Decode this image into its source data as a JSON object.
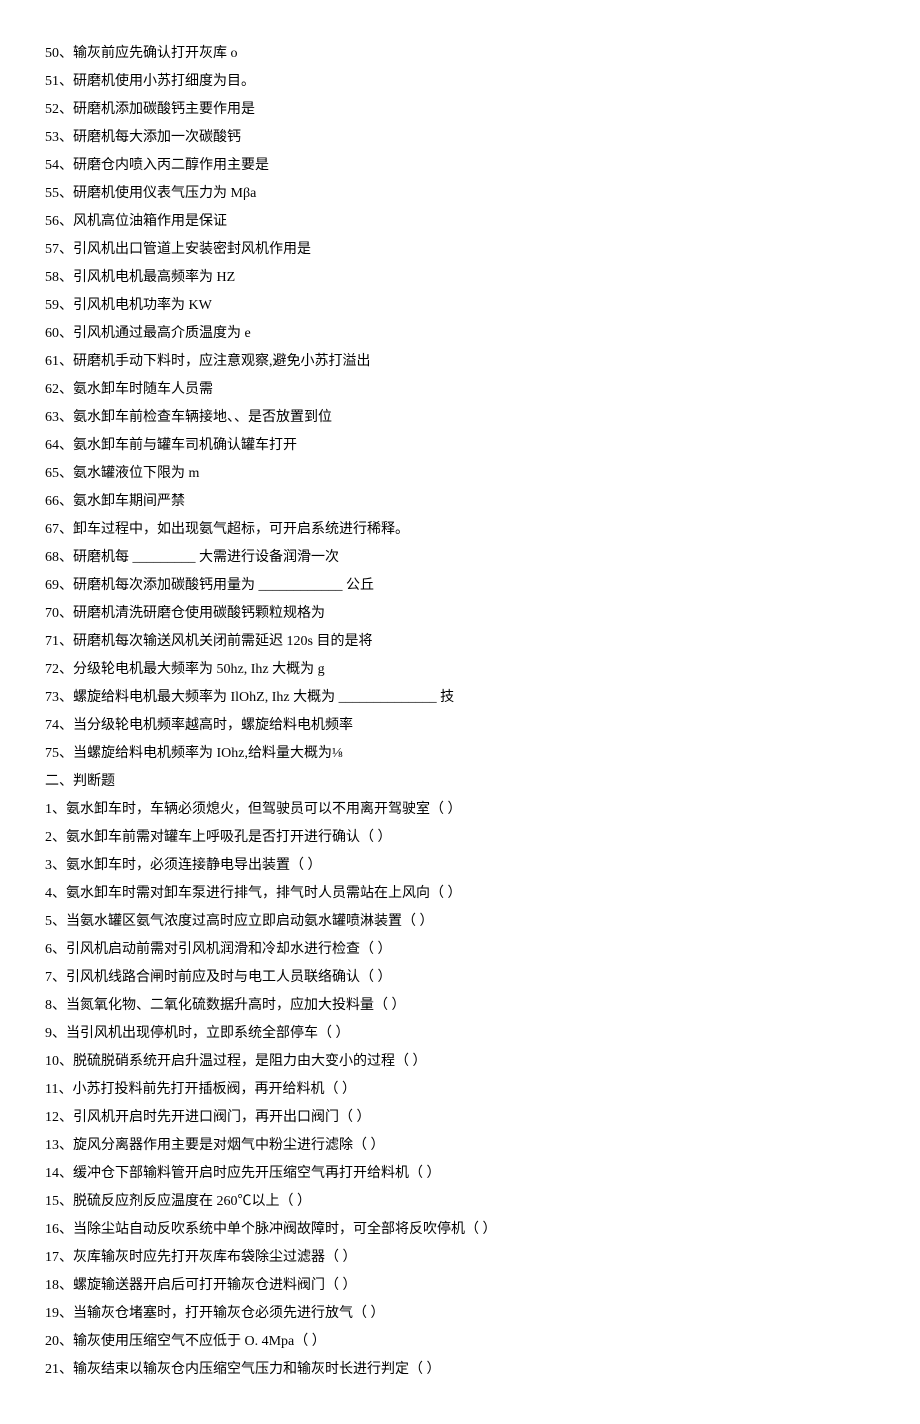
{
  "fill_items": [
    {
      "num": "50",
      "text": "输灰前应先确认打开灰库 o"
    },
    {
      "num": "51",
      "text": "研磨机使用小苏打细度为目。"
    },
    {
      "num": "52",
      "text": "研磨机添加碳酸钙主要作用是"
    },
    {
      "num": "53",
      "text": "研磨机每大添加一次碳酸钙"
    },
    {
      "num": "54",
      "text": "研磨仓内喷入丙二醇作用主要是"
    },
    {
      "num": "55",
      "text": "研磨机使用仪表气压力为 Mβa"
    },
    {
      "num": "56",
      "text": "风机高位油箱作用是保证"
    },
    {
      "num": "57",
      "text": "引风机出口管道上安装密封风机作用是"
    },
    {
      "num": "58",
      "text": "引风机电机最高频率为 HZ"
    },
    {
      "num": "59",
      "text": "引风机电机功率为 KW"
    },
    {
      "num": "60",
      "text": "引风机通过最高介质温度为 e"
    },
    {
      "num": "61",
      "text": "研磨机手动下料时，应注意观察,避免小苏打溢出"
    },
    {
      "num": "62",
      "text": "氨水卸车时随车人员需"
    },
    {
      "num": "63",
      "text": "氨水卸车前检查车辆接地、、是否放置到位"
    },
    {
      "num": "64",
      "text": "氨水卸车前与罐车司机确认罐车打开"
    },
    {
      "num": "65",
      "text": "氨水罐液位下限为 m"
    },
    {
      "num": "66",
      "text": "氨水卸车期间严禁"
    },
    {
      "num": "67",
      "text": "卸车过程中，如出现氨气超标，可开启系统进行稀释。"
    },
    {
      "num": "68",
      "text": "研磨机每 _________ 大需进行设备润滑一次"
    },
    {
      "num": "69",
      "text": "研磨机每次添加碳酸钙用量为 ____________ 公丘"
    },
    {
      "num": "70",
      "text": "研磨机清洗研磨仓使用碳酸钙颗粒规格为"
    },
    {
      "num": "71",
      "text": "研磨机每次输送风机关闭前需延迟 120s 目的是将"
    },
    {
      "num": "72",
      "text": "分级轮电机最大频率为 50hz, Ihz 大概为 g"
    },
    {
      "num": "73",
      "text": "螺旋给料电机最大频率为 IlOhZ, Ihz 大概为 ______________ 技"
    },
    {
      "num": "74",
      "text": "当分级轮电机频率越高时，螺旋给料电机频率"
    },
    {
      "num": "75",
      "text": "当螺旋给料电机频率为 IOhz,给料量大概为⅛"
    }
  ],
  "section2_title": "二、判断题",
  "judge_items": [
    {
      "num": "1",
      "text": "氨水卸车时，车辆必须熄火，但驾驶员可以不用离开驾驶室（           ）"
    },
    {
      "num": "2",
      "text": "氨水卸车前需对罐车上呼吸孔是否打开进行确认（           ）"
    },
    {
      "num": "3",
      "text": "氨水卸车时，必须连接静电导出装置（           ）"
    },
    {
      "num": "4",
      "text": "氨水卸车时需对卸车泵进行排气，排气时人员需站在上风向（           ）"
    },
    {
      "num": "5",
      "text": "当氨水罐区氨气浓度过高时应立即启动氨水罐喷淋装置（           ）"
    },
    {
      "num": "6",
      "text": "引风机启动前需对引风机润滑和冷却水进行检查（           ）"
    },
    {
      "num": "7",
      "text": "引风机线路合闸时前应及时与电工人员联络确认（           ）"
    },
    {
      "num": "8",
      "text": "当氮氧化物、二氧化硫数据升高时，应加大投料量（           ）"
    },
    {
      "num": "9",
      "text": "当引风机出现停机时，立即系统全部停车（           ）"
    },
    {
      "num": "10",
      "text": "脱硫脱硝系统开启升温过程，是阻力由大变小的过程（           ）"
    },
    {
      "num": "11",
      "text": "小苏打投料前先打开插板阀，再开给料机（              ）"
    },
    {
      "num": "12",
      "text": "引风机开启时先开进口阀门，再开出口阀门（           ）"
    },
    {
      "num": "13",
      "text": "旋风分离器作用主要是对烟气中粉尘进行滤除（              ）"
    },
    {
      "num": "14",
      "text": "缓冲仓下部输料管开启时应先开压缩空气再打开给料机（           ）"
    },
    {
      "num": "15",
      "text": "脱硫反应剂反应温度在 260℃以上（           ）"
    },
    {
      "num": "16",
      "text": "当除尘站自动反吹系统中单个脉冲阀故障时，可全部将反吹停机（              ）"
    },
    {
      "num": "17",
      "text": "灰库输灰时应先打开灰库布袋除尘过滤器（              ）"
    },
    {
      "num": "18",
      "text": "螺旋输送器开启后可打开输灰仓进料阀门（           ）"
    },
    {
      "num": "19",
      "text": "当输灰仓堵塞时，打开输灰仓必须先进行放气（              ）"
    },
    {
      "num": "20",
      "text": "输灰使用压缩空气不应低于 O. 4Mpa（           ）"
    },
    {
      "num": "21",
      "text": "输灰结束以输灰仓内压缩空气压力和输灰时长进行判定（              ）"
    }
  ]
}
